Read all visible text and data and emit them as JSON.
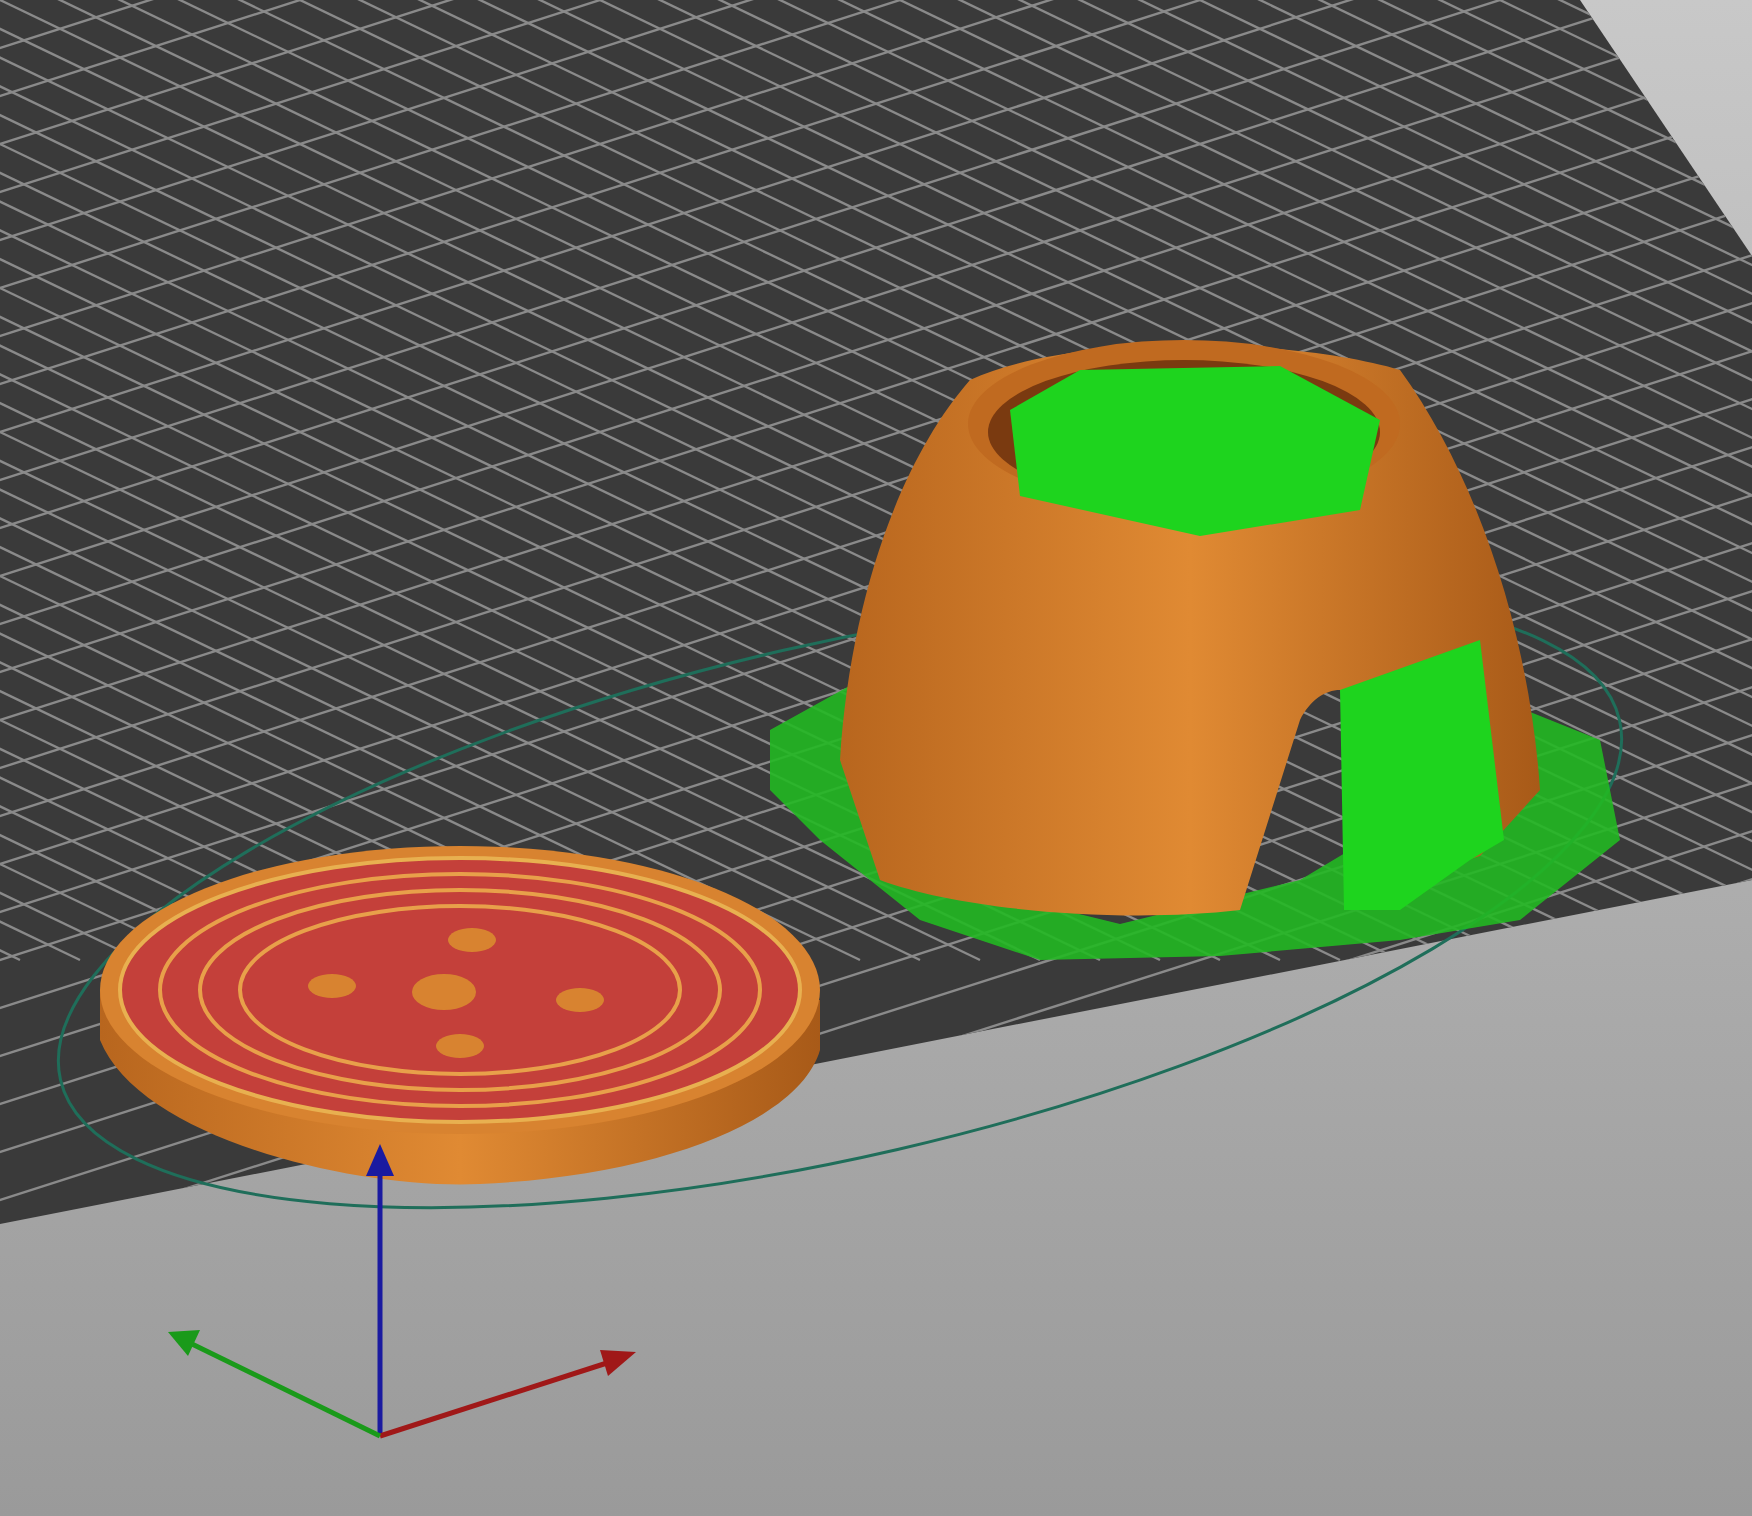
{
  "viewport": {
    "kind": "preview"
  }
}
